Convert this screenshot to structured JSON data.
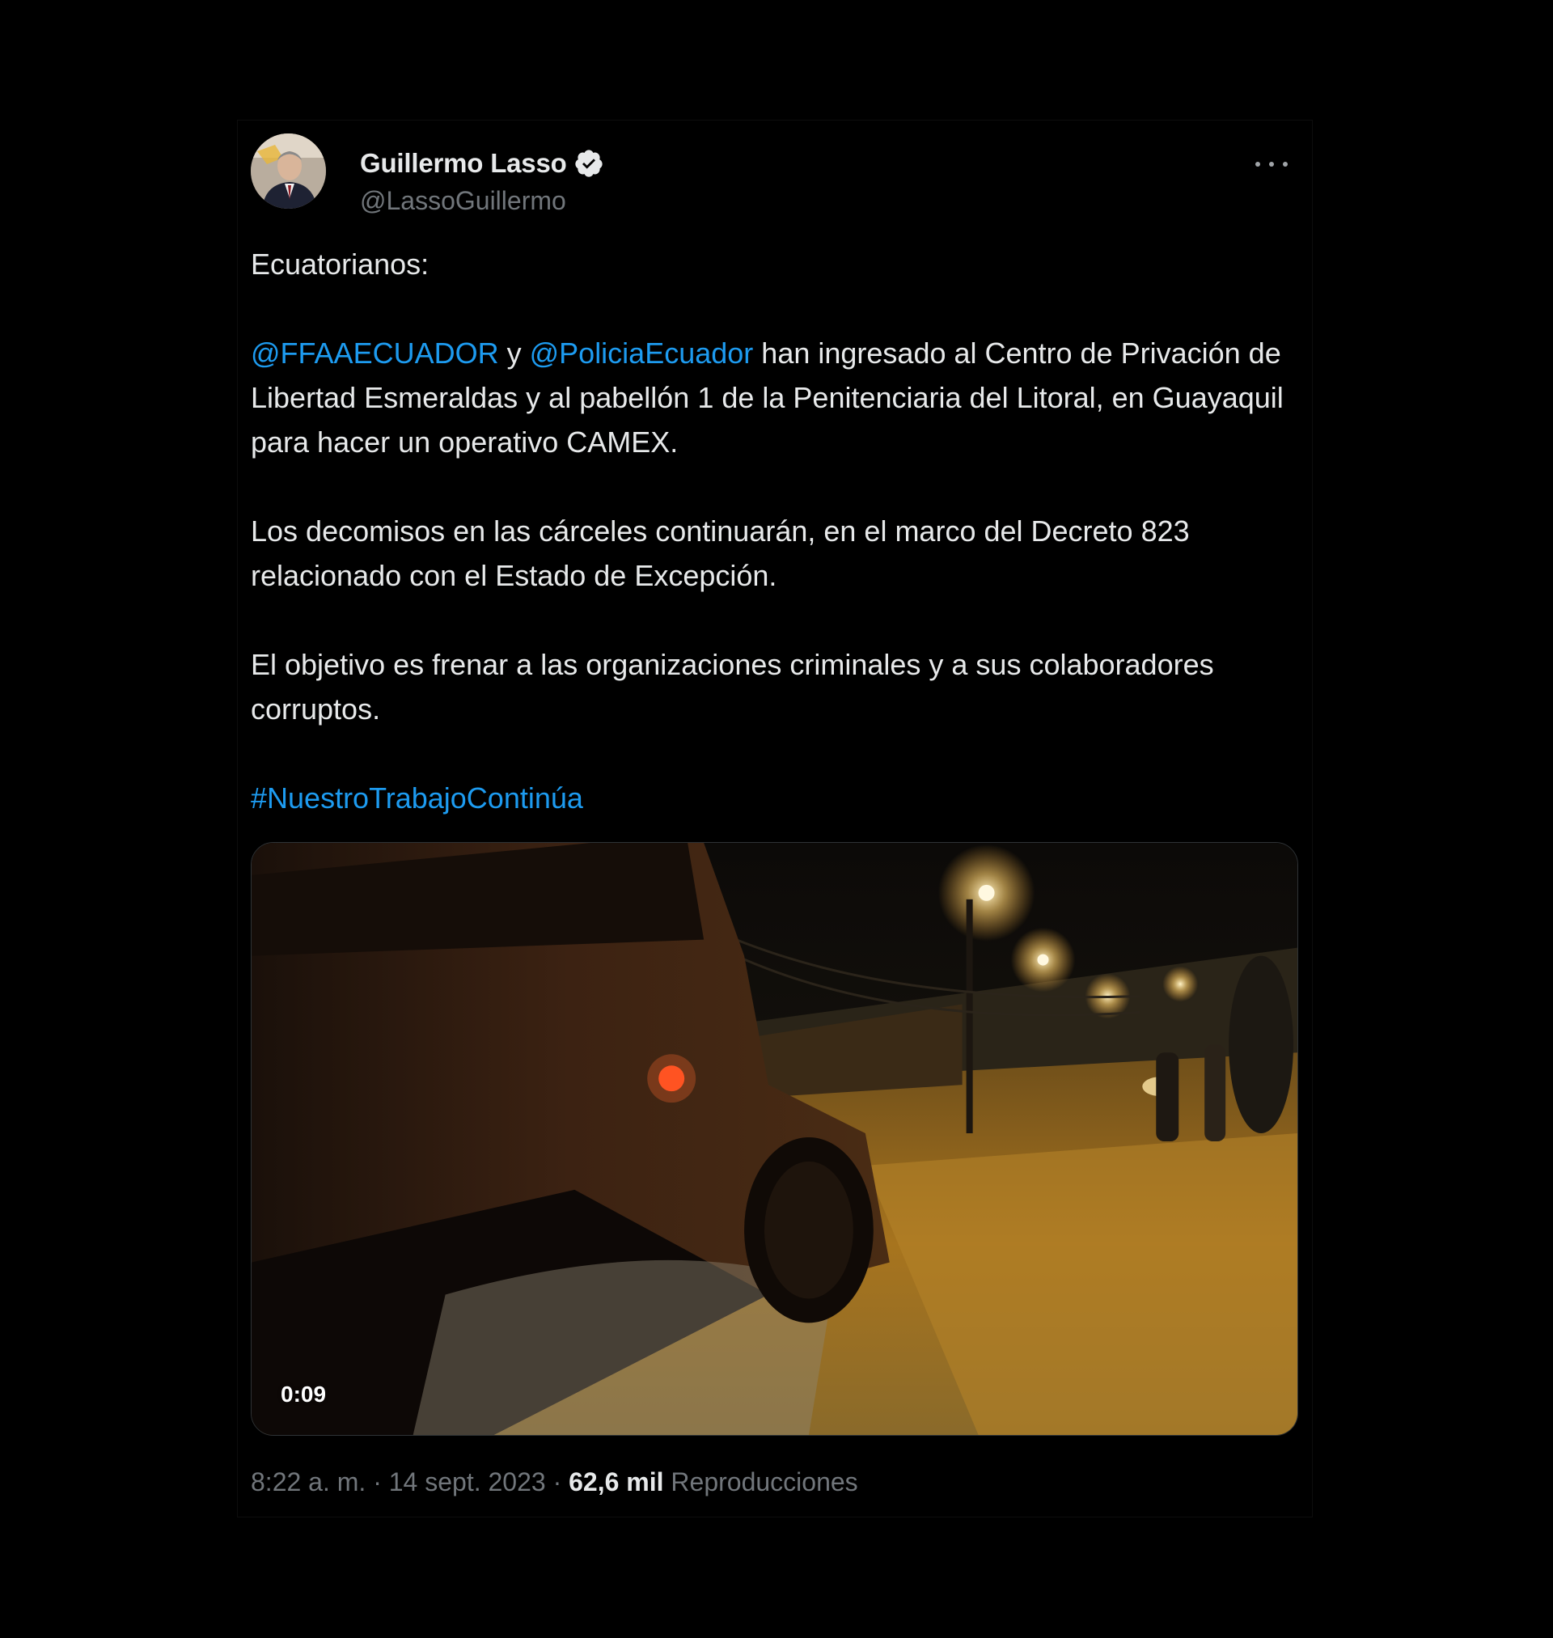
{
  "author": {
    "display_name": "Guillermo Lasso",
    "handle": "@LassoGuillermo",
    "verified_icon": "verified-badge-icon"
  },
  "tweet": {
    "greeting": "Ecuatorianos:",
    "p1_mention1": "@FFAAECUADOR",
    "p1_connector": " y ",
    "p1_mention2": "@PoliciaEcuador",
    "p1_rest": " han ingresado al Centro de Privación de Libertad Esmeraldas y al pabellón 1 de la Penitenciaria del Litoral, en Guayaquil para hacer un operativo CAMEX.",
    "p2": "Los decomisos en las cárceles continuarán, en el marco del Decreto 823 relacionado con el Estado de Excepción.",
    "p3": "El objetivo es frenar a las organizaciones criminales y a sus colaboradores corruptos.",
    "hashtag": "#NuestroTrabajoContinúa"
  },
  "media": {
    "duration": "0:09"
  },
  "meta": {
    "time": "8:22 a. m.",
    "separator1": " · ",
    "date": "14 sept. 2023",
    "separator2": " · ",
    "views_count": "62,6 mil",
    "views_label": " Reproducciones"
  },
  "colors": {
    "link": "#1d9bf0",
    "text": "#e7e9ea",
    "secondary": "#71767b",
    "background": "#000000"
  }
}
